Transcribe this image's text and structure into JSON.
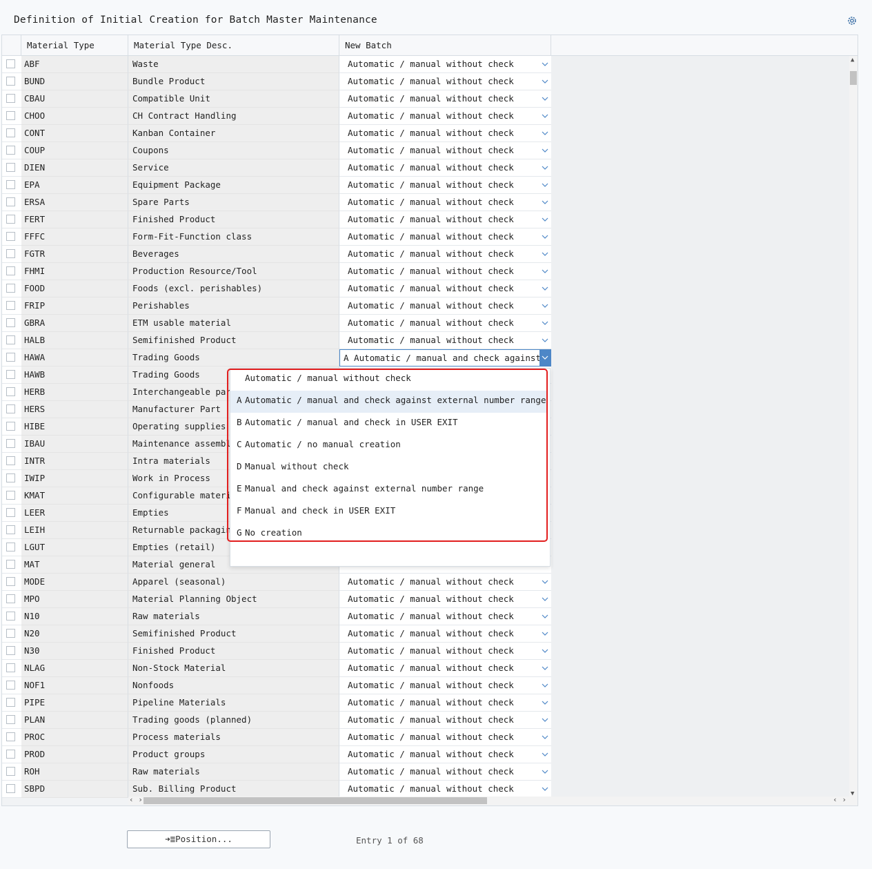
{
  "page": {
    "title": "Definition of Initial Creation for Batch Master Maintenance"
  },
  "header": {
    "col_type": "Material Type",
    "col_desc": "Material Type Desc.",
    "col_batch": "New Batch"
  },
  "rows": [
    {
      "type": "ABF",
      "desc": "Waste",
      "batch": "Automatic / manual without check"
    },
    {
      "type": "BUND",
      "desc": "Bundle Product",
      "batch": "Automatic / manual without check"
    },
    {
      "type": "CBAU",
      "desc": "Compatible Unit",
      "batch": "Automatic / manual without check"
    },
    {
      "type": "CHOO",
      "desc": "CH Contract Handling",
      "batch": "Automatic / manual without check"
    },
    {
      "type": "CONT",
      "desc": "Kanban Container",
      "batch": "Automatic / manual without check"
    },
    {
      "type": "COUP",
      "desc": "Coupons",
      "batch": "Automatic / manual without check"
    },
    {
      "type": "DIEN",
      "desc": "Service",
      "batch": "Automatic / manual without check"
    },
    {
      "type": "EPA",
      "desc": "Equipment Package",
      "batch": "Automatic / manual without check"
    },
    {
      "type": "ERSA",
      "desc": "Spare Parts",
      "batch": "Automatic / manual without check"
    },
    {
      "type": "FERT",
      "desc": "Finished Product",
      "batch": "Automatic / manual without check"
    },
    {
      "type": "FFFC",
      "desc": "Form-Fit-Function class",
      "batch": "Automatic / manual without check"
    },
    {
      "type": "FGTR",
      "desc": "Beverages",
      "batch": "Automatic / manual without check"
    },
    {
      "type": "FHMI",
      "desc": "Production Resource/Tool",
      "batch": "Automatic / manual without check"
    },
    {
      "type": "FOOD",
      "desc": "Foods (excl. perishables)",
      "batch": "Automatic / manual without check"
    },
    {
      "type": "FRIP",
      "desc": "Perishables",
      "batch": "Automatic / manual without check"
    },
    {
      "type": "GBRA",
      "desc": "ETM usable material",
      "batch": "Automatic / manual without check"
    },
    {
      "type": "HALB",
      "desc": "Semifinished Product",
      "batch": "Automatic / manual without check"
    },
    {
      "type": "HAWA",
      "desc": "Trading Goods",
      "batch": "A Automatic / manual and check against ex"
    },
    {
      "type": "HAWB",
      "desc": "Trading Goods",
      "batch": ""
    },
    {
      "type": "HERB",
      "desc": "Interchangeable part",
      "batch": ""
    },
    {
      "type": "HERS",
      "desc": "Manufacturer Part",
      "batch": ""
    },
    {
      "type": "HIBE",
      "desc": "Operating supplies",
      "batch": ""
    },
    {
      "type": "IBAU",
      "desc": "Maintenance assemblie",
      "batch": ""
    },
    {
      "type": "INTR",
      "desc": "Intra materials",
      "batch": ""
    },
    {
      "type": "IWIP",
      "desc": "Work in Process",
      "batch": ""
    },
    {
      "type": "KMAT",
      "desc": "Configurable material",
      "batch": ""
    },
    {
      "type": "LEER",
      "desc": "Empties",
      "batch": ""
    },
    {
      "type": "LEIH",
      "desc": "Returnable packaging",
      "batch": ""
    },
    {
      "type": "LGUT",
      "desc": "Empties (retail)",
      "batch": ""
    },
    {
      "type": "MAT",
      "desc": "Material general",
      "batch": ""
    },
    {
      "type": "MODE",
      "desc": "Apparel (seasonal)",
      "batch": "Automatic / manual without check"
    },
    {
      "type": "MPO",
      "desc": "Material Planning Object",
      "batch": "Automatic / manual without check"
    },
    {
      "type": "N10",
      "desc": "Raw materials",
      "batch": "Automatic / manual without check"
    },
    {
      "type": "N20",
      "desc": "Semifinished Product",
      "batch": "Automatic / manual without check"
    },
    {
      "type": "N30",
      "desc": "Finished Product",
      "batch": "Automatic / manual without check"
    },
    {
      "type": "NLAG",
      "desc": "Non-Stock Material",
      "batch": "Automatic / manual without check"
    },
    {
      "type": "NOF1",
      "desc": "Nonfoods",
      "batch": "Automatic / manual without check"
    },
    {
      "type": "PIPE",
      "desc": "Pipeline Materials",
      "batch": "Automatic / manual without check"
    },
    {
      "type": "PLAN",
      "desc": "Trading goods (planned)",
      "batch": "Automatic / manual without check"
    },
    {
      "type": "PROC",
      "desc": "Process materials",
      "batch": "Automatic / manual without check"
    },
    {
      "type": "PROD",
      "desc": "Product groups",
      "batch": "Automatic / manual without check"
    },
    {
      "type": "ROH",
      "desc": "Raw materials",
      "batch": "Automatic / manual without check"
    },
    {
      "type": "SBPD",
      "desc": "Sub. Billing Product",
      "batch": "Automatic / manual without check"
    }
  ],
  "dropdown": {
    "options": [
      {
        "key": "",
        "label": "Automatic / manual without check"
      },
      {
        "key": "A",
        "label": "Automatic / manual and check against external number range"
      },
      {
        "key": "B",
        "label": "Automatic / manual and check in USER EXIT"
      },
      {
        "key": "C",
        "label": "Automatic / no manual creation"
      },
      {
        "key": "D",
        "label": "Manual without check"
      },
      {
        "key": "E",
        "label": "Manual and check against external number range"
      },
      {
        "key": "F",
        "label": "Manual and check in USER EXIT"
      },
      {
        "key": "G",
        "label": "No creation"
      }
    ],
    "highlighted_key": "A"
  },
  "footer": {
    "position_button": "Position...",
    "position_icon": "arrow-into-list-icon",
    "entry": "Entry 1 of 68"
  },
  "icons": {
    "settings": "gear-icon",
    "dropdown": "chevron-down-icon"
  },
  "colors": {
    "accent": "#4d87c7",
    "highlight_box": "#e21d1d",
    "selected_option": "#e6eef7"
  }
}
